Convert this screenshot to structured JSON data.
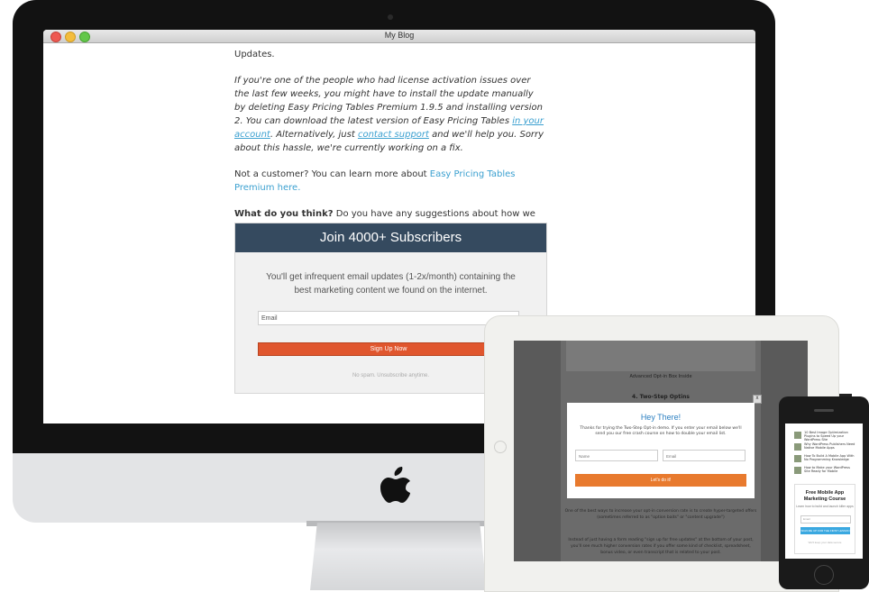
{
  "window": {
    "title": "My Blog",
    "buttons": [
      "close",
      "minimize",
      "zoom"
    ]
  },
  "post": {
    "updates": "Updates.",
    "para1_before": "If you're one of the people who had license activation issues over the last few weeks, you might have to install the update manually by deleting Easy Pricing Tables Premium 1.9.5 and installing version 2. You can download the latest version of Easy Pricing Tables ",
    "link_account": "in your account",
    "para1_mid": ". Alternatively, just ",
    "link_support": "contact support",
    "para1_after": " and we'll help you. Sorry about this hassle, we're currently working on a fix.",
    "para2_before": "Not a customer? You can learn more about ",
    "link_learn": "Easy Pricing Tables Premium here.",
    "para3_bold": "What do you think?",
    "para3_rest": " Do you have any suggestions about how we could improve this plugin even further? Leave a comment below."
  },
  "optin": {
    "heading": "Join 4000+ Subscribers",
    "subtext": "You'll get infrequent email updates (1-2x/month) containing the best marketing content we found on the internet.",
    "email_placeholder": "Email",
    "button": "Sign Up Now",
    "note": "No spam. Unsubscribe anytime."
  },
  "ipad": {
    "bg_caption": "Advanced Opt-in Box Inside",
    "bg_heading": "4. Two-Step Optins",
    "modal_title": "Hey There!",
    "modal_text": "Thanks for trying the Two-Step Opt-in demo. If you enter your email below we'll send you our free crash course on how to double your email list.",
    "name_placeholder": "Name",
    "email_placeholder": "Email",
    "modal_button": "Let's do it!",
    "close_glyph": "x",
    "bg_para1": "One of the best ways to increase your opt-in conversion rate is to create hyper-targeted offers (sometimes referred to as \"option baits\" or \"content upgrade\")",
    "bg_para2": "Instead of just having a form reading \"sign up for free updates\" at the bottom of your post, you'll see much higher conversion rates if you offer some kind of checklist, spreadsheet, bonus video, or even transcript that is related to your post."
  },
  "iphone": {
    "list_items": [
      "10 Best Image Optimization Plugins to Speed Up your WordPress Site",
      "Why WordPress Publishers Need Native Mobile Apps",
      "How To Build A Mobile App With No Programming Knowledge",
      "How to Make your WordPress Site Ready for Mobile"
    ],
    "card_title": "Free Mobile App Marketing Course",
    "card_sub": "Learn how to build and launch killer apps",
    "email_placeholder": "Email",
    "button": "SIGN ME UP FOR THE FIRST LESSON",
    "note": "We'll keep your data secure"
  }
}
